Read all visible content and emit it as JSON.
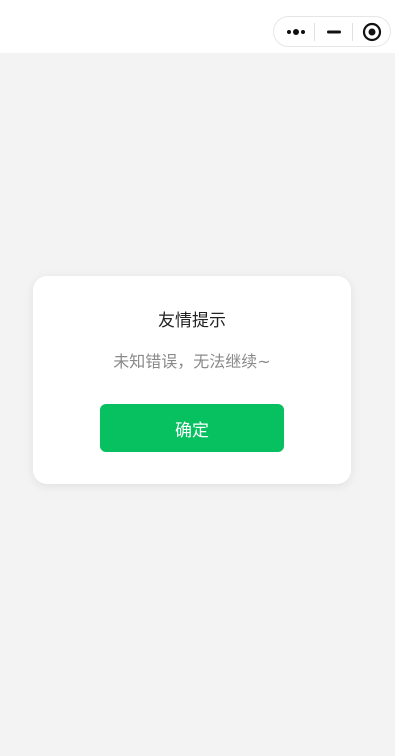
{
  "capsule": {
    "more_icon": "more-dots-icon",
    "minimize_icon": "minimize-icon",
    "close_icon": "target-close-icon"
  },
  "dialog": {
    "title": "友情提示",
    "message": "未知错误，无法继续~",
    "confirm_label": "确定"
  },
  "colors": {
    "background": "#f3f3f3",
    "accent": "#07c160"
  }
}
